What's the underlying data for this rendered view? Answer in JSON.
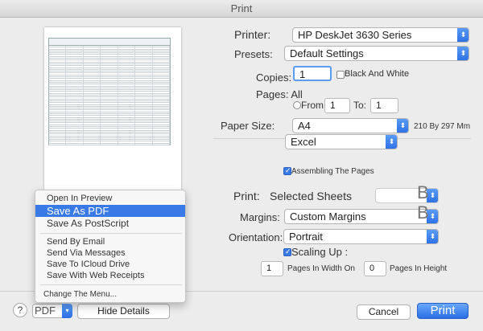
{
  "window": {
    "title": "Print"
  },
  "printer": {
    "label": "Printer:",
    "value": "HP DeskJet 3630 Series"
  },
  "presets": {
    "label": "Presets:",
    "value": "Default Settings"
  },
  "copies": {
    "label": "Copies:",
    "value": "1",
    "bw_label": "Black And White"
  },
  "pages": {
    "label": "Pages: All",
    "from_label": "From:",
    "from_value": "1",
    "to_label": "To:",
    "to_value": "1"
  },
  "paper": {
    "label": "Paper Size:",
    "value": "A4",
    "dimensions": "210 By 297 Mm"
  },
  "app_section": {
    "value": "Excel"
  },
  "assembling": {
    "label": "Assembling The Pages"
  },
  "print_what": {
    "label": "Print:",
    "value": "Selected Sheets"
  },
  "margins": {
    "label": "Margins:",
    "value": "Custom Margins"
  },
  "orientation": {
    "label": "Orientation:",
    "value": "Portrait"
  },
  "scaling": {
    "label": "Scaling Up :",
    "width_value": "1",
    "width_label": "Pages In Width On",
    "height_value": "0",
    "height_label": "Pages In Height"
  },
  "pdf_menu": {
    "items": [
      "Open In Preview",
      "Save As PDF",
      "Save As PostScript",
      "Send By Email",
      "Send Via Messages",
      "Save To ICloud Drive",
      "Save With Web Receipts",
      "Change The Menu..."
    ]
  },
  "footer": {
    "help": "?",
    "pdf": "PDF",
    "hide_details": "Hide Details",
    "cancel": "Cancel",
    "print": "Print"
  },
  "glyphs": {
    "B": "B"
  },
  "colors": {
    "accent": "#3a7ae6"
  }
}
